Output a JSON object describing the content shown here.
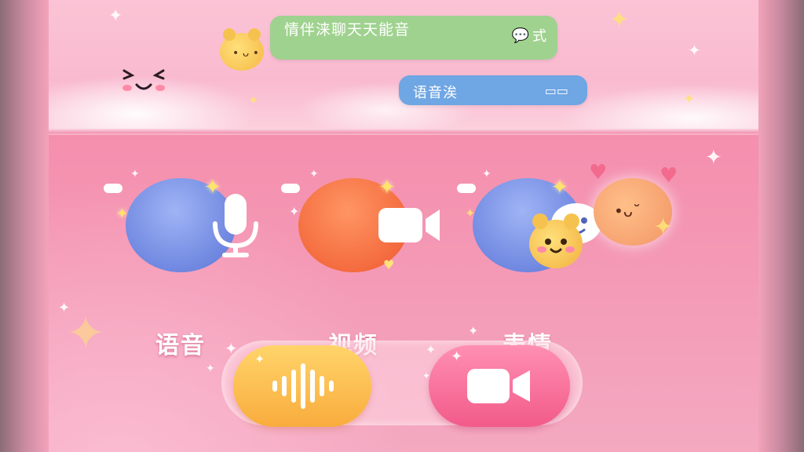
{
  "chat": {
    "message_green": "情伴涞聊天天能音",
    "message_green_suffix": "式",
    "message_blue": "语音涘"
  },
  "features": [
    {
      "label": "语音",
      "icon": "microphone-icon"
    },
    {
      "label": "视频",
      "icon": "video-camera-icon"
    },
    {
      "label": "表情",
      "icon": "chat-emoji-icon"
    }
  ],
  "actions": {
    "voice_button_icon": "sound-wave-icon",
    "video_button_icon": "video-camera-icon"
  },
  "colors": {
    "green_bubble": "#9fd28f",
    "blue_bubble": "#6fa6e4",
    "voice_circle": "#6f87e0",
    "video_circle": "#f46b3e",
    "voice_button": "#f9ac3d",
    "video_button": "#f25b8a"
  }
}
